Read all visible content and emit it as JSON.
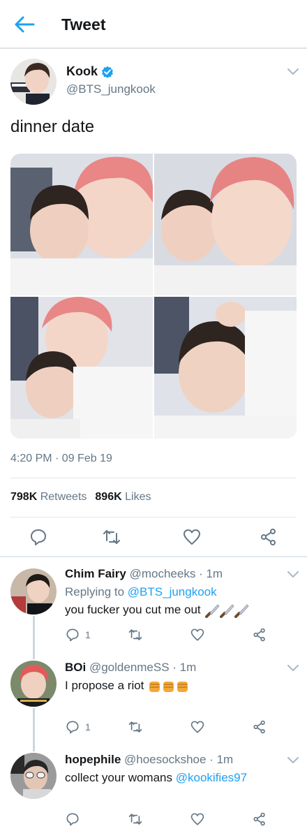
{
  "header": {
    "title": "Tweet",
    "back_icon": "arrow-left-icon"
  },
  "tweet": {
    "author_name": "Kook",
    "author_handle": "@BTS_jungkook",
    "verified": true,
    "text": "dinner date",
    "timestamp": "4:20 PM · 09 Feb 19",
    "retweets_count": "798K",
    "retweets_label": "Retweets",
    "likes_count": "896K",
    "likes_label": "Likes",
    "media_count": 4
  },
  "replies": [
    {
      "name": "Chim Fairy",
      "meta": "@mocheeks · 1m",
      "replying_prefix": "Replying to",
      "replying_to": "@BTS_jungkook",
      "text": "you fucker you cut me out",
      "reply_count": "1"
    },
    {
      "name": "BOi",
      "meta": "@goldenmeSS · 1m",
      "text": "I propose a riot",
      "reply_count": "1"
    },
    {
      "name": "hopephile",
      "meta": "@hoesockshoe · 1m",
      "text": "collect your womans",
      "mention": "@kookifies97"
    }
  ],
  "colors": {
    "accent": "#1da1f2",
    "text": "#14171a",
    "secondary": "#657786",
    "divider": "#e1e8ed"
  }
}
